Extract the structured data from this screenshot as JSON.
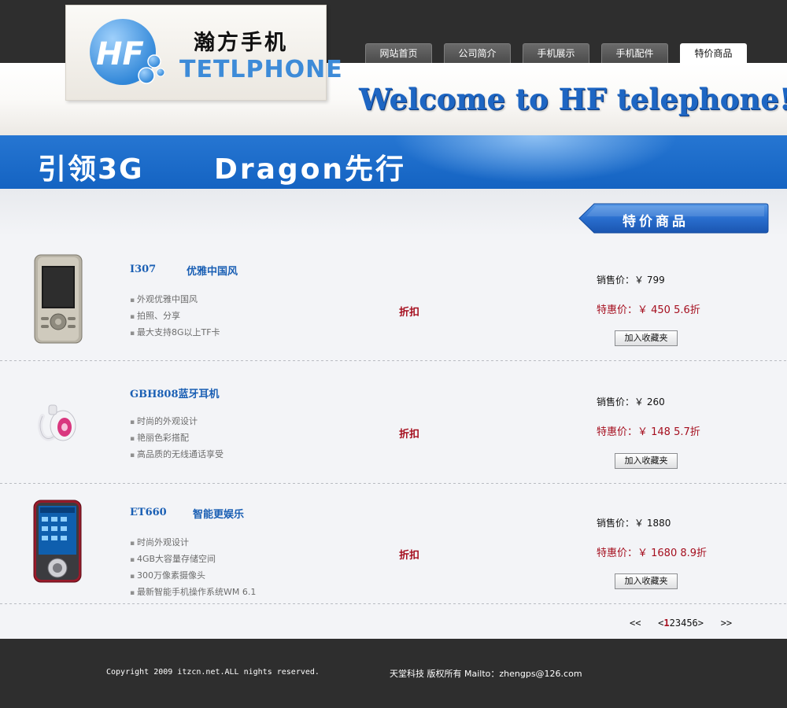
{
  "header": {
    "logo_cn": "瀚方手机",
    "logo_en": "TETLPHONE",
    "welcome": "Welcome to HF telephone!"
  },
  "nav": {
    "items": [
      "网站首页",
      "公司简介",
      "手机展示",
      "手机配件",
      "特价商品"
    ],
    "active": "特价商品"
  },
  "banner": {
    "slogan1": "引领3G",
    "slogan2": "Dragon先行"
  },
  "section": {
    "title": "特价商品"
  },
  "products": [
    {
      "model": "I307",
      "slogan": "优雅中国风",
      "features": [
        "外观优雅中国风",
        "拍照、分享",
        "最大支持8G以上TF卡"
      ],
      "discount_label": "折扣",
      "price_text": "销售价：￥ 799",
      "special_text": "特惠价：￥ 450  5.6折",
      "add_label": "加入收藏夹"
    },
    {
      "model": "GBH808蓝牙耳机",
      "slogan": "",
      "features": [
        "时尚的外观设计",
        "艳丽色彩搭配",
        "高品质的无线通话享受"
      ],
      "discount_label": "折扣",
      "price_text": "销售价：￥ 260",
      "special_text": "特惠价：￥ 148  5.7折",
      "add_label": "加入收藏夹"
    },
    {
      "model": "ET660",
      "slogan": "智能更娱乐",
      "features": [
        "时尚外观设计",
        "4GB大容量存储空间",
        "300万像素摄像头",
        "最新智能手机操作系统WM 6.1"
      ],
      "discount_label": "折扣",
      "price_text": "销售价：￥ 1880",
      "special_text": "特惠价：￥ 1680  8.9折",
      "add_label": "加入收藏夹"
    }
  ],
  "pager": {
    "first": "<<",
    "prev": "<",
    "pages": [
      "1",
      "2",
      "3",
      "4",
      "5",
      "6"
    ],
    "current": "1",
    "next": ">",
    "last": ">>"
  },
  "footer": {
    "copyright": "Copyright 2009 itzcn.net.ALL nights reserved.",
    "owner": "天堂科技 版权所有 Mailto：zhengps@126.com"
  },
  "colors": {
    "accent_blue": "#1a5fb4",
    "discount_red": "#a50e1e",
    "dark_bar": "#2e2e2e"
  }
}
